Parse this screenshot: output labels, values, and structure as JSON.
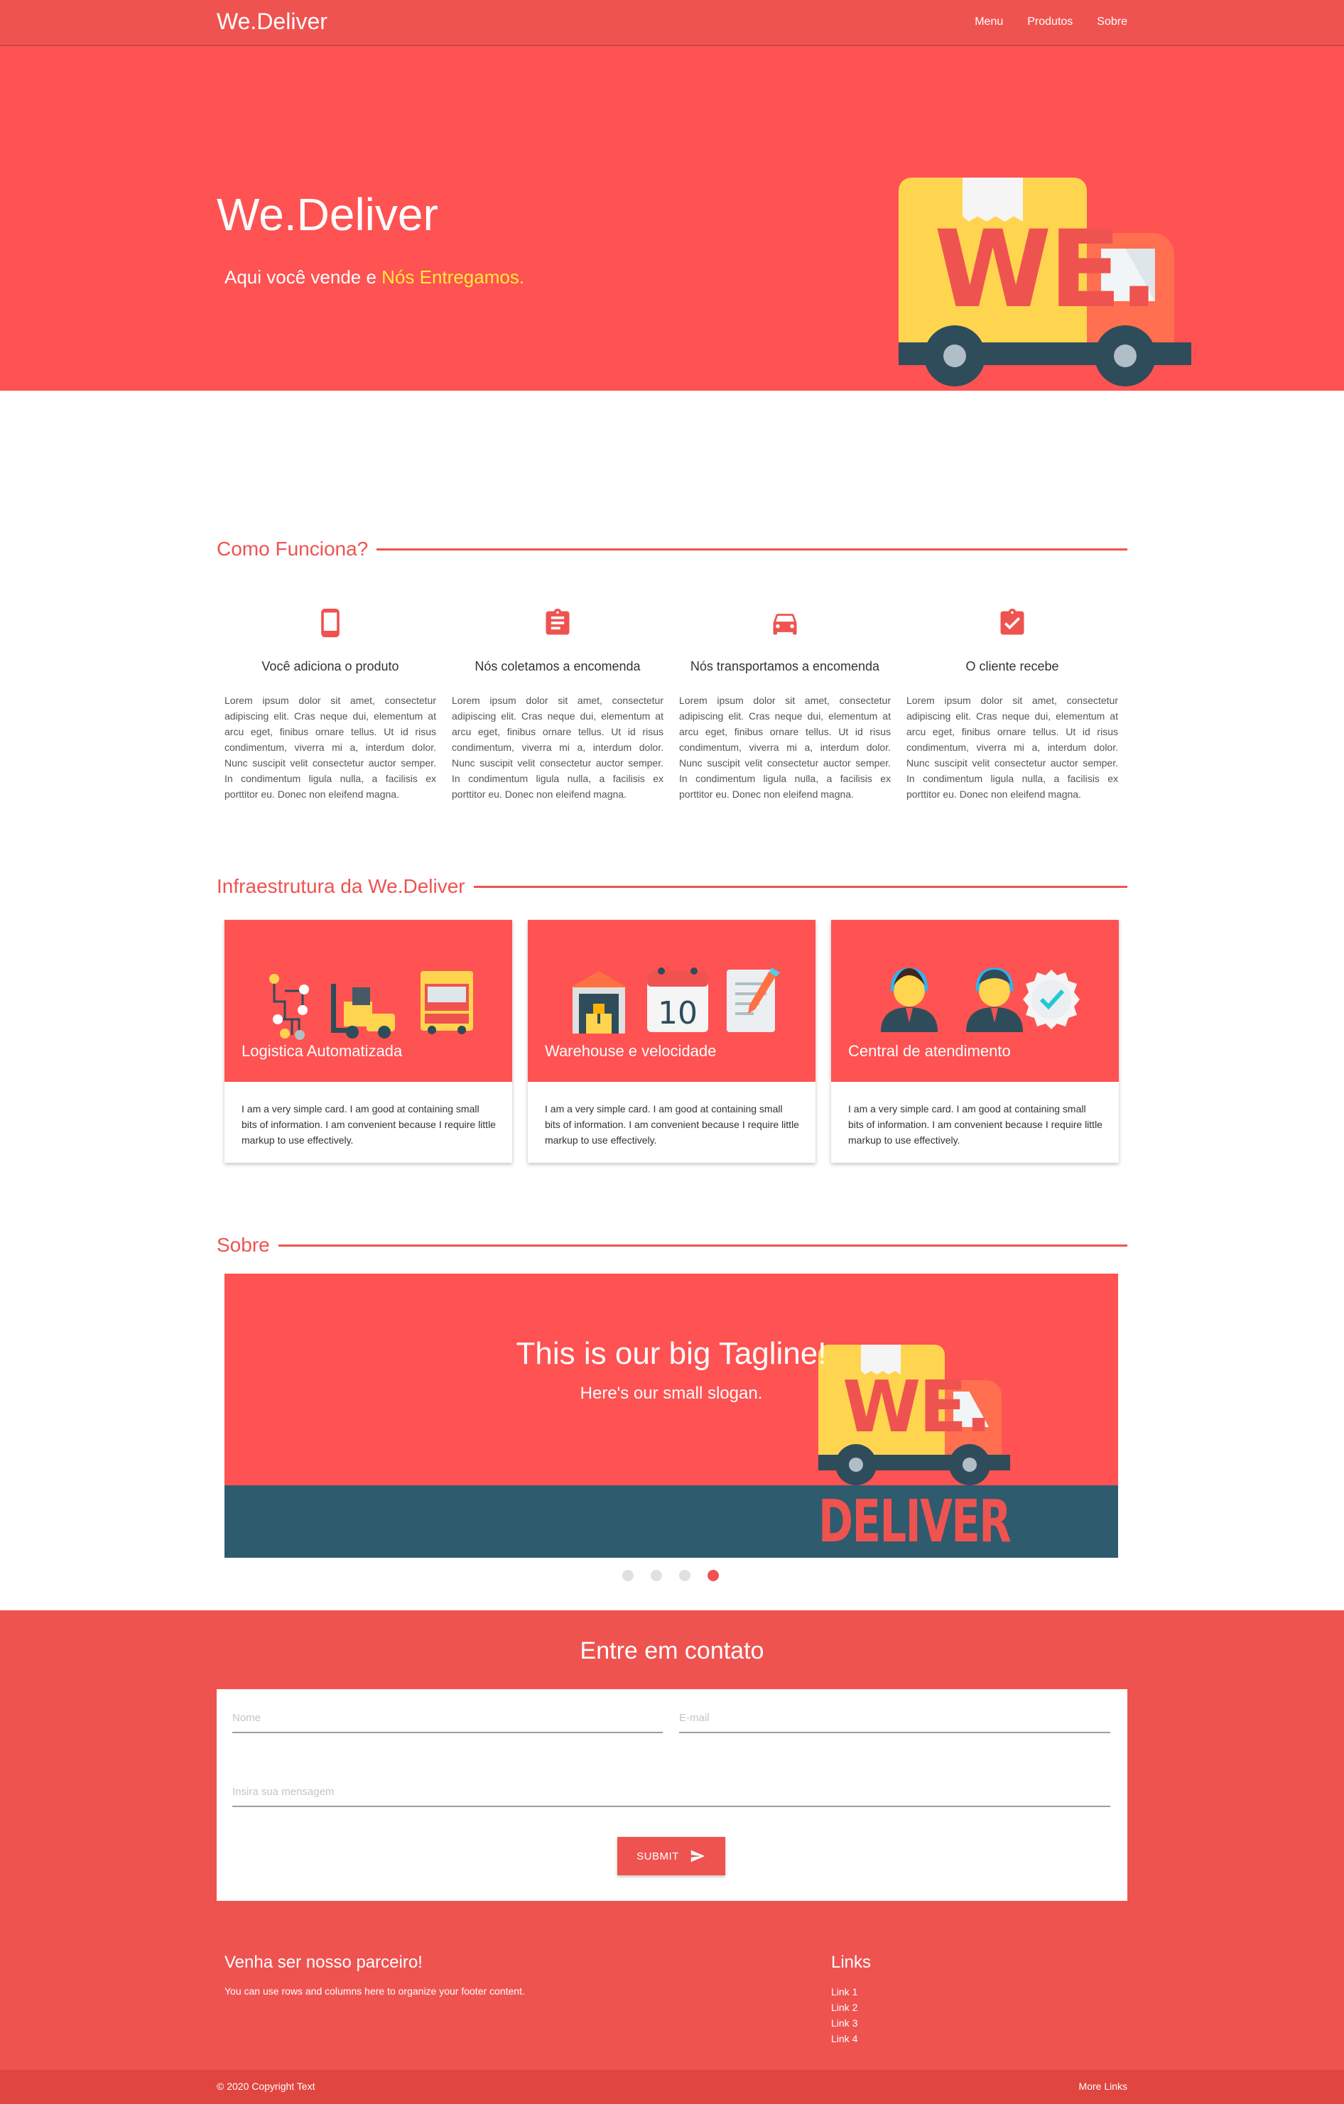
{
  "nav": {
    "brand": "We.Deliver",
    "links": [
      "Menu",
      "Produtos",
      "Sobre"
    ]
  },
  "hero": {
    "title": "We.Deliver",
    "subtitle_prefix": "Aqui você vende e",
    "subtitle_highlight": "Nós Entregamos.",
    "logo_top": "WE.",
    "logo_bottom": "DELIVER"
  },
  "how": {
    "heading": "Como Funciona?",
    "steps": [
      {
        "icon": "smartphone-icon",
        "title": "Você adiciona o produto",
        "text": "Lorem ipsum dolor sit amet, consectetur adipiscing elit. Cras neque dui, elementum at arcu eget, finibus ornare tellus. Ut id risus condimentum, viverra mi a, interdum dolor. Nunc suscipit velit consectetur auctor semper. In condimentum ligula nulla, a facilisis ex porttitor eu. Donec non eleifend magna."
      },
      {
        "icon": "clipboard-icon",
        "title": "Nós coletamos a encomenda",
        "text": "Lorem ipsum dolor sit amet, consectetur adipiscing elit. Cras neque dui, elementum at arcu eget, finibus ornare tellus. Ut id risus condimentum, viverra mi a, interdum dolor. Nunc suscipit velit consectetur auctor semper. In condimentum ligula nulla, a facilisis ex porttitor eu. Donec non eleifend magna."
      },
      {
        "icon": "car-icon",
        "title": "Nós transportamos a encomenda",
        "text": "Lorem ipsum dolor sit amet, consectetur adipiscing elit. Cras neque dui, elementum at arcu eget, finibus ornare tellus. Ut id risus condimentum, viverra mi a, interdum dolor. Nunc suscipit velit consectetur auctor semper. In condimentum ligula nulla, a facilisis ex porttitor eu. Donec non eleifend magna."
      },
      {
        "icon": "assignment-check-icon",
        "title": "O cliente recebe",
        "text": "Lorem ipsum dolor sit amet, consectetur adipiscing elit. Cras neque dui, elementum at arcu eget, finibus ornare tellus. Ut id risus condimentum, viverra mi a, interdum dolor. Nunc suscipit velit consectetur auctor semper. In condimentum ligula nulla, a facilisis ex porttitor eu. Donec non eleifend magna."
      }
    ]
  },
  "infra": {
    "heading": "Infraestrutura da We.Deliver",
    "cards": [
      {
        "title": "Logistica Automatizada",
        "text": "I am a very simple card. I am good at containing small bits of information. I am convenient because I require little markup to use effectively."
      },
      {
        "title": "Warehouse e velocidade",
        "text": "I am a very simple card. I am good at containing small bits of information. I am convenient because I require little markup to use effectively.",
        "calendar_day": "10"
      },
      {
        "title": "Central de atendimento",
        "text": "I am a very simple card. I am good at containing small bits of information. I am convenient because I require little markup to use effectively."
      }
    ]
  },
  "about": {
    "heading": "Sobre",
    "tagline": "This is our big Tagline!",
    "slogan": "Here's our small slogan.",
    "slides_total": 4,
    "active_slide": 4
  },
  "contact": {
    "heading": "Entre em contato",
    "name_placeholder": "Nome",
    "email_placeholder": "E-mail",
    "message_placeholder": "Insira sua mensagem",
    "submit_label": "SUBMIT"
  },
  "footer": {
    "partner_title": "Venha ser nosso parceiro!",
    "partner_text": "You can use rows and columns here to organize your footer content.",
    "links_title": "Links",
    "links": [
      "Link 1",
      "Link 2",
      "Link 3",
      "Link 4"
    ],
    "copyright": "© 2020 Copyright Text",
    "more_links": "More Links"
  },
  "colors": {
    "primary": "#ef5350",
    "hero_red": "#ff5252",
    "band_blue": "#2f5b6e",
    "highlight_yellow": "#ffeb3b"
  }
}
